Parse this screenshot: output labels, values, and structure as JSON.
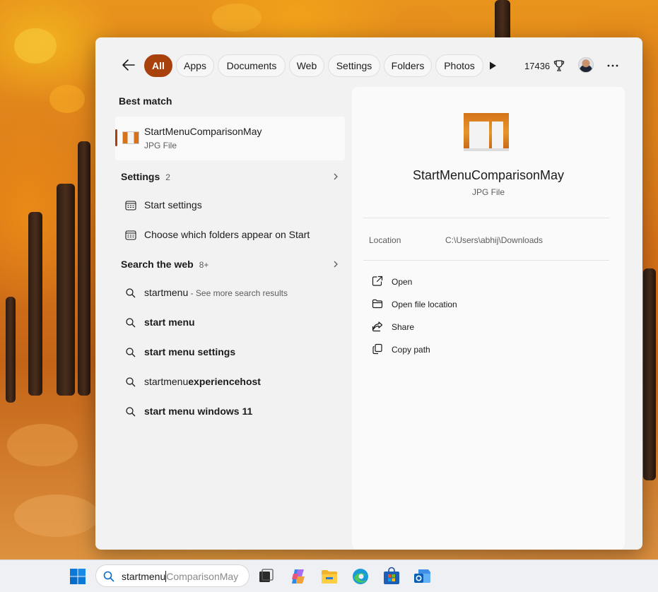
{
  "filters": {
    "all": "All",
    "apps": "Apps",
    "documents": "Documents",
    "web": "Web",
    "settings": "Settings",
    "folders": "Folders",
    "photos": "Photos"
  },
  "header": {
    "points": "17436"
  },
  "best_match": {
    "heading": "Best match",
    "title": "StartMenuComparisonMay",
    "subtitle": "JPG File"
  },
  "settings_section": {
    "heading": "Settings",
    "count": "2",
    "items": [
      {
        "label": "Start settings"
      },
      {
        "label": "Choose which folders appear on Start"
      }
    ]
  },
  "web_section": {
    "heading": "Search the web",
    "count": "8+",
    "items": [
      {
        "label": "startmenu",
        "hint": " - See more search results"
      },
      {
        "label": "start menu"
      },
      {
        "label": "start menu settings"
      },
      {
        "prefix": "startmenu",
        "bold": "experiencehost"
      },
      {
        "label": "start menu windows 11"
      }
    ]
  },
  "preview": {
    "title": "StartMenuComparisonMay",
    "subtitle": "JPG File",
    "location_label": "Location",
    "location_value": "C:\\Users\\abhij\\Downloads",
    "actions": [
      {
        "label": "Open",
        "icon": "open-external-icon"
      },
      {
        "label": "Open file location",
        "icon": "folder-icon"
      },
      {
        "label": "Share",
        "icon": "share-icon"
      },
      {
        "label": "Copy path",
        "icon": "copy-icon"
      }
    ]
  },
  "taskbar": {
    "search_typed": "startmenu",
    "search_ghost": "ComparisonMay",
    "icons": [
      "windows-start-icon",
      "task-view-icon",
      "copilot-icon",
      "file-explorer-icon",
      "edge-icon",
      "store-icon",
      "outlook-icon"
    ]
  },
  "colors": {
    "accent": "#a8410c",
    "panel_bg": "#f2f2f2",
    "preview_bg": "#fafafa"
  }
}
